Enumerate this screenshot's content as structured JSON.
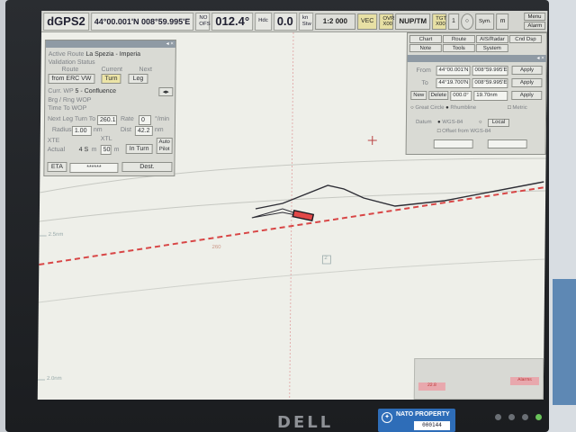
{
  "topbar": {
    "source": "dGPS2",
    "position": "44°00.001'N 008°59.995'E",
    "no_ofs": "NO OFS",
    "heading": "012.4°",
    "heading_unit": "Hdc",
    "speed": "0.0",
    "speed_unit": "kn Stw",
    "scale": "1:2 000",
    "vec": "VEC",
    "ovr": "OVR X00",
    "orient": "NUP/TM",
    "tgt": "TGT X00",
    "one": "1",
    "sym": "Sym.",
    "m": "m",
    "menu": "Menu",
    "alarm": "Alarm"
  },
  "route_panel": {
    "active_route_label": "Active Route",
    "active_route": "La Spezia - Imperia",
    "validation_label": "Validation Status",
    "route_label": "Route",
    "current_label": "Current",
    "next_label": "Next",
    "btn_route": "from ERC VW",
    "btn_turn": "Turn",
    "btn_leg": "Leg",
    "curr_wp_label": "Curr. WP",
    "curr_wp": "5 - Confluence",
    "brg_rng_label": "Brg / Rng WOP",
    "time_label": "Time To WOP",
    "next_leg_label": "Next Leg Turn To",
    "next_leg": "260.1",
    "rate_label": "Rate",
    "rate": "0",
    "rate_unit": "°/min",
    "radius_label": "Radius",
    "radius": "1.00",
    "radius_unit": "nm",
    "dist_label": "Dist",
    "dist": "42.2",
    "dist_unit": "nm",
    "xte_label": "XTE",
    "xtl_label": "XTL",
    "actual_label": "Actual",
    "actual": "4 S",
    "actual_unit": "m",
    "xtl": "50",
    "xtl_unit": "m",
    "in_turn": "In Turn",
    "auto_pilot": "Auto Pilot",
    "eta_label": "ETA",
    "eta": "******",
    "dest": "Dest."
  },
  "right_panel": {
    "tabs": [
      "Chart",
      "Route",
      "AIS/Radar",
      "Cnd Dsp",
      "Note",
      "Tools",
      "System"
    ],
    "from_label": "From",
    "from_lat": "44°00.001'N",
    "from_lon": "008°59.995'E",
    "apply": "Apply",
    "to_label": "To",
    "to_lat": "44°19.700'N",
    "to_lon": "008°59.995'E",
    "apply2": "Apply",
    "new": "New",
    "delete": "Delete",
    "brg": "000.0°",
    "rng": "19.70nm",
    "apply3": "Apply",
    "great_circle": "Great Circle",
    "rhumbline": "Rhumbline",
    "metric": "Metric",
    "datum_label": "Datum",
    "wgs84": "WGS-84",
    "local": "Local",
    "offset": "Offset from WGS-84"
  },
  "chart": {
    "course_label": "260",
    "scale_tick_top": "2.5nm",
    "scale_tick_bottom": "2.0nm",
    "marker": "2",
    "ghost_left": "22.8",
    "ghost_right": "Alarms"
  },
  "hardware": {
    "brand": "DELL",
    "tag_title": "NATO PROPERTY",
    "tag_number": "000144"
  }
}
